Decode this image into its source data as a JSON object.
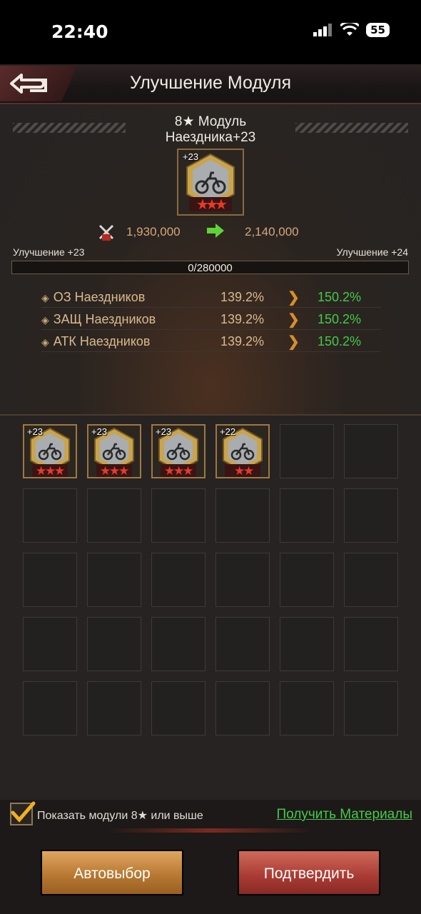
{
  "status_bar": {
    "time": "22:40",
    "battery": "55"
  },
  "header": {
    "title": "Улучшение Модуля"
  },
  "module": {
    "name_line1": "8★ Модуль",
    "name_line2": "Наездника+23",
    "level_badge": "+23",
    "stars": 3
  },
  "power": {
    "current": "1,930,000",
    "next": "2,140,000"
  },
  "upgrade": {
    "current_label": "Улучшение +23",
    "next_label": "Улучшение +24",
    "progress_text": "0/280000",
    "progress_fraction": 0
  },
  "stats": [
    {
      "name": "ОЗ Наездников",
      "current": "139.2%",
      "next": "150.2%"
    },
    {
      "name": "ЗАЩ Наездников",
      "current": "139.2%",
      "next": "150.2%"
    },
    {
      "name": "АТК Наездников",
      "current": "139.2%",
      "next": "150.2%"
    }
  ],
  "inventory": {
    "items": [
      {
        "level": "+23",
        "stars": 3
      },
      {
        "level": "+23",
        "stars": 3
      },
      {
        "level": "+23",
        "stars": 3
      },
      {
        "level": "+22",
        "stars": 2
      }
    ],
    "total_slots": 30
  },
  "footer": {
    "show_checkbox_label": "Показать модули 8★ или выше",
    "show_checked": true,
    "get_materials_link": "Получить Материалы",
    "auto_button": "Автовыбор",
    "confirm_button": "Подтвердить"
  },
  "colors": {
    "green": "#44c94a",
    "gold": "#d9b98f",
    "accent_orange": "#d58f2b"
  }
}
